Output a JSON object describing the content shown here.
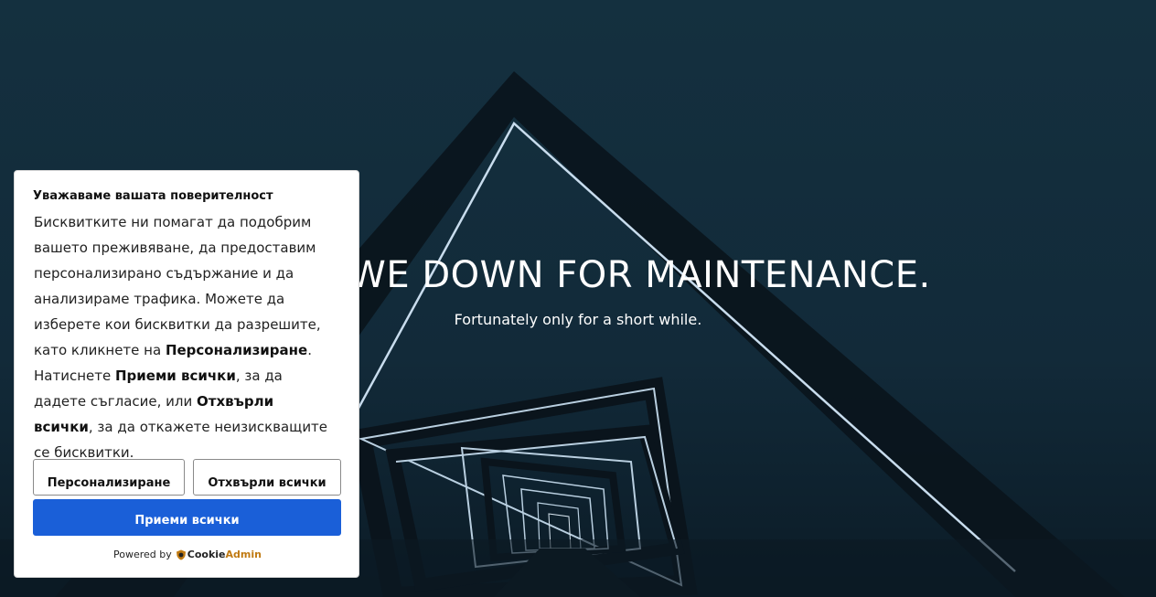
{
  "hero": {
    "title": "WE DOWN FOR MAINTENANCE.",
    "subtitle": "Fortunately only for a short while."
  },
  "cookie_banner": {
    "title": "Уважаваме вашата поверителност",
    "text_1": "Бисквитките ни помагат да подобрим вашето преживяване, да предоставим персонализирано съдържание и да анализираме трафика. Можете да изберете кои бисквитки да разрешите, като кликнете на ",
    "text_bold_1": "Персонализиране",
    "text_2": ". Натиснете ",
    "text_bold_2": "Приеми всички",
    "text_3": ", за да дадете съгласие, или ",
    "text_bold_3": "Отхвърли всички",
    "text_4": ", за да откажете неизискващите се бисквитки.",
    "customize_label": "Персонализиране",
    "reject_label": "Отхвърли всички",
    "accept_label": "Приеми всички",
    "powered_by": "Powered by",
    "brand_part1": "Cookie",
    "brand_part2": "Admin"
  },
  "colors": {
    "accept_button": "#1a5fd8",
    "background": "#0f2433",
    "brand_accent": "#c07a12"
  }
}
